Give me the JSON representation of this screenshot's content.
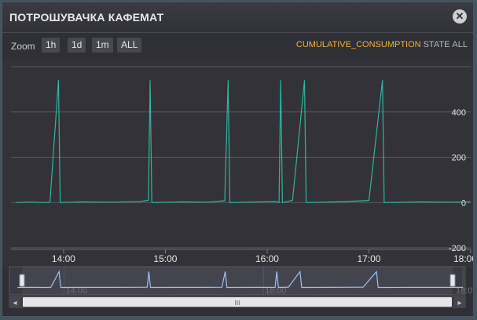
{
  "window": {
    "title": "ПОТРОШУВАЧКА КАФЕМАТ",
    "close_icon": "close-icon"
  },
  "toolbar": {
    "zoom_label": "Zoom",
    "zoom_buttons": [
      "1h",
      "1d",
      "1m",
      "ALL"
    ],
    "legend": {
      "cumulative": "CUMULATIVE_CONSUMPTION",
      "state": "STATE",
      "all": "ALL"
    }
  },
  "colors": {
    "series": "#2fb5a0",
    "navigator_series": "#9fc0ea",
    "legend_active": "#f2b134"
  },
  "chart_data": {
    "type": "line",
    "x_axis": {
      "ticks": [
        "14:00",
        "15:00",
        "16:00",
        "17:00",
        "18:00"
      ]
    },
    "y_axis": {
      "ticks": [
        400,
        200,
        0,
        -200
      ],
      "ylim": [
        -200,
        600
      ]
    },
    "grid": true,
    "series": [
      {
        "name": "CUMULATIVE_CONSUMPTION",
        "points": [
          [
            "13:32",
            0
          ],
          [
            "13:37",
            2
          ],
          [
            "13:42",
            2
          ],
          [
            "13:47",
            0
          ],
          [
            "13:52",
            2
          ],
          [
            "13:57",
            540
          ],
          [
            "13:58",
            0
          ],
          [
            "14:10",
            3
          ],
          [
            "14:30",
            2
          ],
          [
            "14:45",
            5
          ],
          [
            "14:50",
            10
          ],
          [
            "14:51",
            540
          ],
          [
            "14:52",
            0
          ],
          [
            "15:10",
            3
          ],
          [
            "15:25",
            2
          ],
          [
            "15:35",
            8
          ],
          [
            "15:37",
            540
          ],
          [
            "15:38",
            0
          ],
          [
            "15:55",
            3
          ],
          [
            "16:05",
            5
          ],
          [
            "16:07",
            0
          ],
          [
            "16:08",
            540
          ],
          [
            "16:09",
            0
          ],
          [
            "16:15",
            10
          ],
          [
            "16:22",
            540
          ],
          [
            "16:23",
            0
          ],
          [
            "16:40",
            3
          ],
          [
            "16:58",
            8
          ],
          [
            "17:00",
            10
          ],
          [
            "17:08",
            540
          ],
          [
            "17:09",
            0
          ],
          [
            "17:30",
            3
          ],
          [
            "17:50",
            2
          ],
          [
            "18:00",
            3
          ]
        ]
      }
    ],
    "navigator": {
      "ticks": [
        "14:00",
        "16:00",
        "18:00"
      ]
    }
  },
  "scrollbar": {
    "left_arrow": "◂",
    "right_arrow": "▸",
    "grip": "III"
  }
}
